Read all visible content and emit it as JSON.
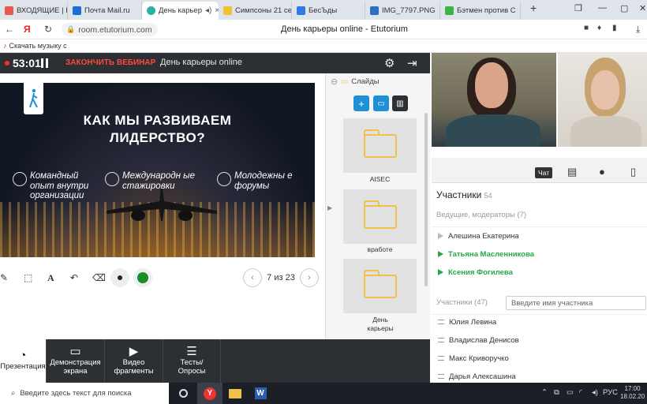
{
  "browser": {
    "tabs": [
      {
        "label": "ВХОДЯЩИЕ | Ке"
      },
      {
        "label": "Почта Mail.ru"
      },
      {
        "label": "День карьер",
        "active": true
      },
      {
        "label": "Симпсоны 21 се"
      },
      {
        "label": "БесЪды"
      },
      {
        "label": "IMG_7797.PNG"
      },
      {
        "label": "Бэтмен против С"
      }
    ],
    "new_tab": "+",
    "url": "room.etutorium.com",
    "page_title": "День карьеры online - Etutorium",
    "bookmark": "Скачать музыку с"
  },
  "header": {
    "timer": "53:01",
    "end_button": "ЗАКОНЧИТЬ ВЕБИНАР",
    "webinar_name": "День карьеры online"
  },
  "slide": {
    "title_line1": "КАК МЫ РАЗВИВАЕМ",
    "title_line2": "ЛИДЕРСТВО?",
    "items": [
      "Командный опыт внутри организации",
      "Международн ые стажировки",
      "Молодежны е форумы"
    ]
  },
  "pager": {
    "text": "7 из 23"
  },
  "slides_panel": {
    "header": "Слайды",
    "folders": [
      {
        "label": "AISEC"
      },
      {
        "label": "вработе"
      },
      {
        "label": "День карьеры"
      }
    ]
  },
  "bottombar": {
    "items": [
      {
        "label": "Презентация"
      },
      {
        "label": "Демонстрация экрана"
      },
      {
        "label": "Видео фрагменты"
      },
      {
        "label": "Тесты/ Опросы"
      }
    ]
  },
  "right_panel": {
    "chat_tab": "Чат",
    "participants_title": "Участники",
    "participants_count": "54",
    "moderators_label": "Ведущие, модераторы (7)",
    "moderators": [
      {
        "name": "Алешина Екатерина",
        "status": "offline"
      },
      {
        "name": "Татьяна Масленникова",
        "status": "online"
      },
      {
        "name": "Ксения Фогилева",
        "status": "online"
      }
    ],
    "participants_label": "Участники (47)",
    "search_placeholder": "Введите имя участника",
    "participants": [
      {
        "name": "Юлия Левина"
      },
      {
        "name": "Владислав Денисов"
      },
      {
        "name": "Макс Криворучко"
      },
      {
        "name": "Дарья Алексашина"
      }
    ]
  },
  "taskbar": {
    "search_placeholder": "Введите здесь текст для поиска",
    "language": "РУС",
    "time": "17:00",
    "date": "18.02.20"
  },
  "colors": {
    "accent_blue": "#1e90d6",
    "end_red": "#ff4a3d",
    "online_green": "#27a845",
    "dark_bar": "#2c2f33"
  },
  "icons": [
    "gear-icon",
    "exit-icon",
    "folder-icon",
    "add-icon",
    "open-folder-icon",
    "trash-icon",
    "chat-icon",
    "user-icon",
    "document-icon"
  ]
}
